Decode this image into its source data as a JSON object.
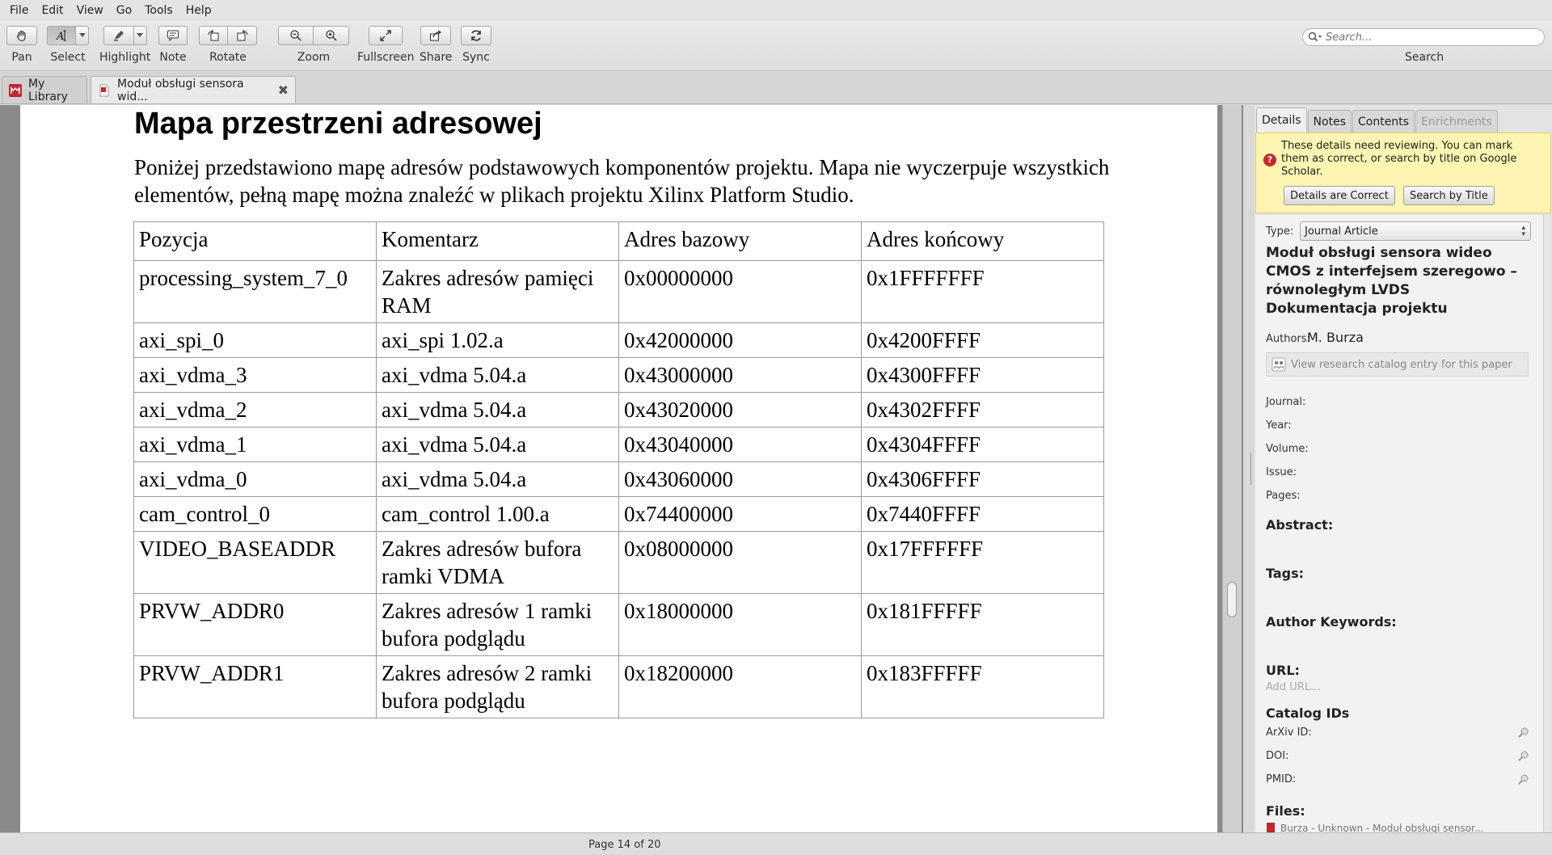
{
  "menu": [
    "File",
    "Edit",
    "View",
    "Go",
    "Tools",
    "Help"
  ],
  "toolbar": {
    "pan": "Pan",
    "select": "Select",
    "highlight": "Highlight",
    "note": "Note",
    "rotate": "Rotate",
    "zoom": "Zoom",
    "fullscreen": "Fullscreen",
    "share": "Share",
    "sync": "Sync",
    "search_placeholder": "Search...",
    "search_label": "Search"
  },
  "tabs": {
    "library": "My Library",
    "document": "Moduł obsługi sensora wid...",
    "close_glyph": "✖"
  },
  "document": {
    "heading": "Mapa przestrzeni adresowej",
    "paragraph": "Poniżej przedstawiono mapę adresów podstawowych komponentów projektu. Mapa nie wyczerpuje wszystkich elementów, pełną mapę można znaleźć w plikach projektu Xilinx Platform Studio.",
    "table": {
      "headers": [
        "Pozycja",
        "Komentarz",
        "Adres bazowy",
        "Adres końcowy"
      ],
      "rows": [
        [
          "processing_system_7_0",
          "Zakres adresów pamięci RAM",
          "0x00000000",
          "0x1FFFFFFF"
        ],
        [
          "axi_spi_0",
          "axi_spi 1.02.a",
          "0x42000000",
          "0x4200FFFF"
        ],
        [
          "axi_vdma_3",
          "axi_vdma 5.04.a",
          "0x43000000",
          "0x4300FFFF"
        ],
        [
          "axi_vdma_2",
          "axi_vdma 5.04.a",
          "0x43020000",
          "0x4302FFFF"
        ],
        [
          "axi_vdma_1",
          "axi_vdma 5.04.a",
          "0x43040000",
          "0x4304FFFF"
        ],
        [
          "axi_vdma_0",
          "axi_vdma 5.04.a",
          "0x43060000",
          "0x4306FFFF"
        ],
        [
          "cam_control_0",
          "cam_control 1.00.a",
          "0x74400000",
          "0x7440FFFF"
        ],
        [
          "VIDEO_BASEADDR",
          "Zakres adresów bufora ramki VDMA",
          "0x08000000",
          "0x17FFFFFF"
        ],
        [
          "PRVW_ADDR0",
          "Zakres adresów 1 ramki bufora podglądu",
          "0x18000000",
          "0x181FFFFF"
        ],
        [
          "PRVW_ADDR1",
          "Zakres adresów 2 ramki bufora podglądu",
          "0x18200000",
          "0x183FFFFF"
        ]
      ]
    }
  },
  "side_panel": {
    "tabs": [
      "Details",
      "Notes",
      "Contents",
      "Enrichments"
    ],
    "review_message": "These details need reviewing. You can mark them as correct, or search by title on Google Scholar.",
    "details_correct_btn": "Details are Correct",
    "search_by_title_btn": "Search by Title",
    "type_label": "Type:",
    "type_value": "Journal Article",
    "title": "Moduł obsługi sensora wideo CMOS z interfejsem szeregowo – równoległym LVDS Dokumentacja projektu",
    "authors_label": "Authors:",
    "author": "M. Burza",
    "catalog_link": "View research catalog entry for this paper",
    "journal_label": "Journal:",
    "year_label": "Year:",
    "volume_label": "Volume:",
    "issue_label": "Issue:",
    "pages_label": "Pages:",
    "abstract_head": "Abstract:",
    "tags_head": "Tags:",
    "keywords_head": "Author Keywords:",
    "url_head": "URL:",
    "url_placeholder": "Add URL...",
    "catalog_head": "Catalog IDs",
    "arxiv_label": "ArXiv ID:",
    "doi_label": "DOI:",
    "pmid_label": "PMID:",
    "files_head": "Files:",
    "file_entry": "Burza - Unknown - Moduł obsługi sensor..."
  },
  "status": {
    "page_indicator": "Page 14 of 20"
  },
  "colors": {
    "review_bg": "#fff5b3",
    "warning_red": "#c9282d",
    "pdf_red": "#c0282d"
  }
}
